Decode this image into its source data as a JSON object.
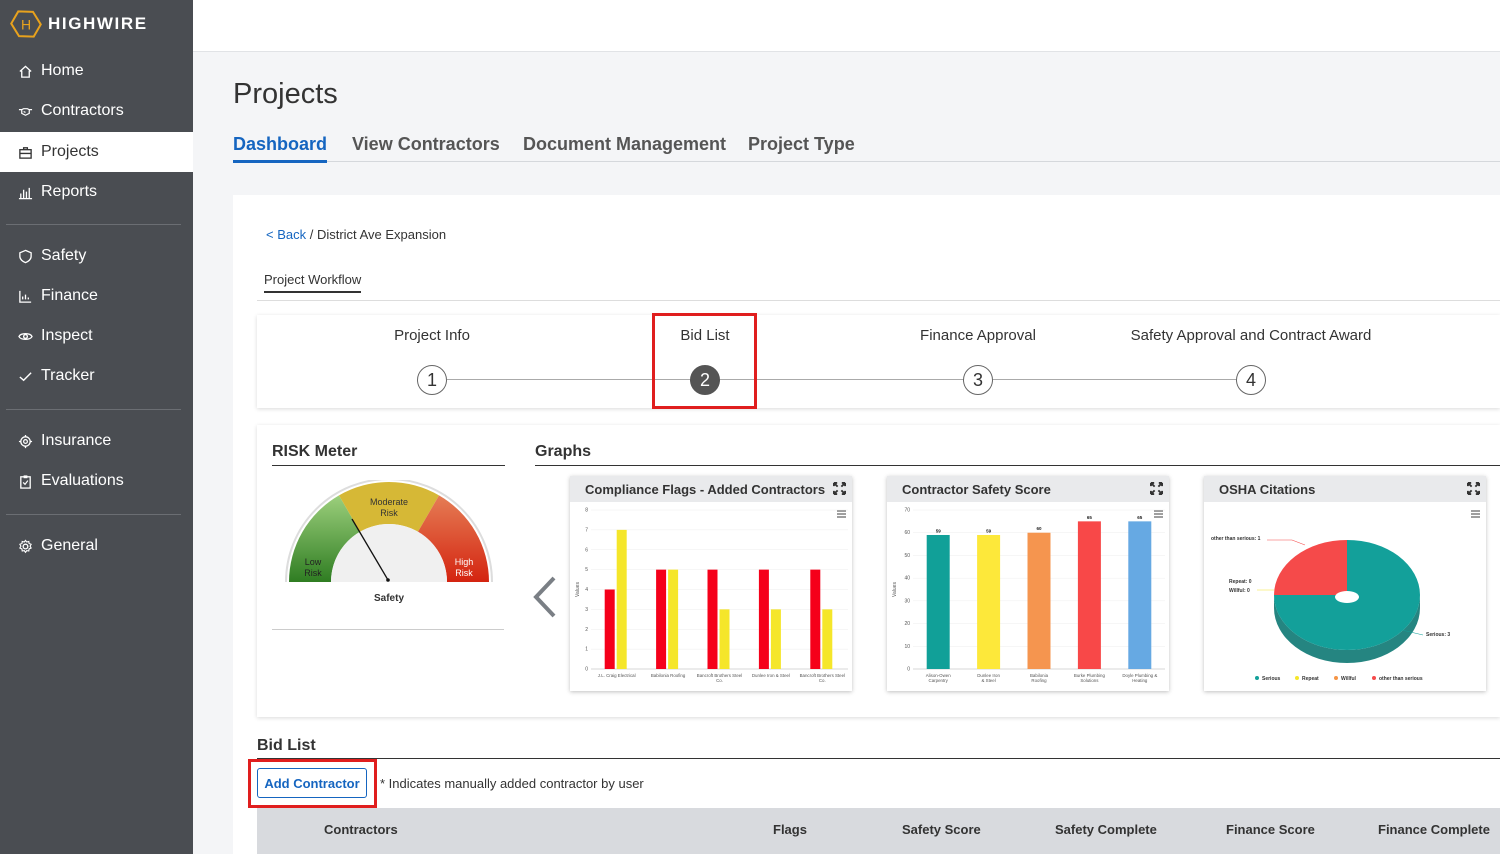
{
  "brand": {
    "name": "HIGHWIRE",
    "mark": "H",
    "accent": "#e8a21d"
  },
  "sidebar": {
    "items": [
      {
        "label": "Home",
        "icon": "home-icon"
      },
      {
        "label": "Contractors",
        "icon": "handshake-icon"
      },
      {
        "label": "Projects",
        "icon": "briefcase-icon",
        "active": true
      },
      {
        "label": "Reports",
        "icon": "bar-chart-icon"
      },
      {
        "label": "Safety",
        "icon": "shield-icon"
      },
      {
        "label": "Finance",
        "icon": "line-chart-icon"
      },
      {
        "label": "Inspect",
        "icon": "eye-icon"
      },
      {
        "label": "Tracker",
        "icon": "check-icon"
      },
      {
        "label": "Insurance",
        "icon": "gear-icon"
      },
      {
        "label": "Evaluations",
        "icon": "clipboard-icon"
      },
      {
        "label": "General",
        "icon": "cog-icon"
      }
    ]
  },
  "page": {
    "title": "Projects"
  },
  "tabs": [
    {
      "label": "Dashboard",
      "active": true
    },
    {
      "label": "View Contractors"
    },
    {
      "label": "Document Management"
    },
    {
      "label": "Project Type"
    }
  ],
  "breadcrumb": {
    "back": "< Back",
    "separator": " / ",
    "current": "District Ave Expansion"
  },
  "workflow": {
    "label": "Project Workflow",
    "steps": [
      {
        "number": "1",
        "label": "Project Info"
      },
      {
        "number": "2",
        "label": "Bid List",
        "active": true
      },
      {
        "number": "3",
        "label": "Finance Approval"
      },
      {
        "number": "4",
        "label": "Safety Approval and Contract Award"
      }
    ]
  },
  "risk_meter": {
    "title": "RISK Meter",
    "labels": {
      "low": [
        "Low",
        "Risk"
      ],
      "moderate": [
        "Moderate",
        "Risk"
      ],
      "high": [
        "High",
        "Risk"
      ]
    },
    "metric": "Safety",
    "colors": {
      "low": "#3a8f2c",
      "moderate": "#d6b836",
      "high": "#d63a22"
    }
  },
  "graphs": {
    "title": "Graphs",
    "charts_data": "see chart_data"
  },
  "chart_data": [
    {
      "type": "bar",
      "title": "Compliance Flags - Added Contractors",
      "ylabel": "Values",
      "ylim": [
        0,
        8
      ],
      "yticks": [
        "0",
        "1",
        "2",
        "3",
        "4",
        "5",
        "6",
        "7",
        "8"
      ],
      "categories": [
        "J.L. Craig Electrical",
        "Babilonia Roofing",
        "Bancroft Brothers Steel Co.",
        "Dunlee Iron & Steel",
        "Bancroft Brothers Steel Co."
      ],
      "series": [
        {
          "values": [
            4,
            5,
            5,
            5,
            5
          ],
          "color": "#f5001a"
        },
        {
          "values": [
            7,
            5,
            3,
            3,
            3
          ],
          "color": "#f5e62a"
        }
      ]
    },
    {
      "type": "bar",
      "title": "Contractor Safety Score",
      "ylabel": "Values",
      "ylim": [
        0,
        70
      ],
      "yticks": [
        "0",
        "10",
        "20",
        "30",
        "40",
        "50",
        "60",
        "70"
      ],
      "categories": [
        "Alison-Owen Carpentry",
        "Dunlee Iron & Steel",
        "Babilonia Roofing",
        "Burke Plumbing Solutions",
        "Doyle Plumbing & Heating"
      ],
      "values": [
        59,
        59,
        60,
        65,
        65
      ],
      "data_labels": [
        "59",
        "59",
        "60",
        "65",
        "65"
      ],
      "colors": [
        "#11a098",
        "#fde83a",
        "#f5954f",
        "#f84848",
        "#66a9e3"
      ]
    },
    {
      "type": "pie",
      "title": "OSHA Citations",
      "slices": [
        {
          "name": "Serious",
          "value": 3,
          "color": "#13a09a",
          "label": "Serious: 3"
        },
        {
          "name": "Repeat",
          "value": 0,
          "color": "#f5e62a",
          "label": "Repeat: 0"
        },
        {
          "name": "Willful",
          "value": 0,
          "color": "#f59546",
          "label": "Willful: 0"
        },
        {
          "name": "other than serious",
          "value": 1,
          "color": "#f54a4a",
          "label": "other than serious: 1"
        }
      ],
      "legend": "bottom"
    }
  ],
  "bid_list": {
    "title": "Bid List",
    "add_button": "Add Contractor",
    "note": "* Indicates manually added contractor by user",
    "columns": [
      "Contractors",
      "Flags",
      "Safety Score",
      "Safety Complete",
      "Finance Score",
      "Finance Complete"
    ]
  }
}
